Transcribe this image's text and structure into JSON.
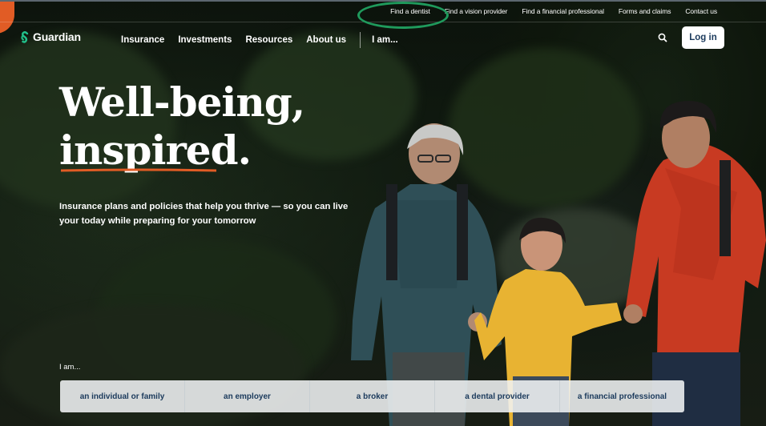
{
  "utility_nav": {
    "links": [
      "Find a dentist",
      "Find a vision provider",
      "Find a financial professional",
      "Forms and claims",
      "Contact us"
    ]
  },
  "brand": {
    "name": "Guardian",
    "accent": "#e15c25",
    "navy": "#1b3a5c",
    "highlight_ring": "#1f9a5c"
  },
  "main_nav": {
    "items": [
      "Insurance",
      "Investments",
      "Resources",
      "About us"
    ],
    "i_am": "I am...",
    "search_icon": "search-icon",
    "login_label": "Log in"
  },
  "hero": {
    "title_line1": "Well-being,",
    "title_line2": "inspired.",
    "subtitle": "Insurance plans and policies that help you thrive — so you can live your today while preparing for your tomorrow"
  },
  "audience": {
    "label": "I am...",
    "options": [
      "an individual or family",
      "an employer",
      "a broker",
      "a dental provider",
      "a financial professional"
    ]
  }
}
